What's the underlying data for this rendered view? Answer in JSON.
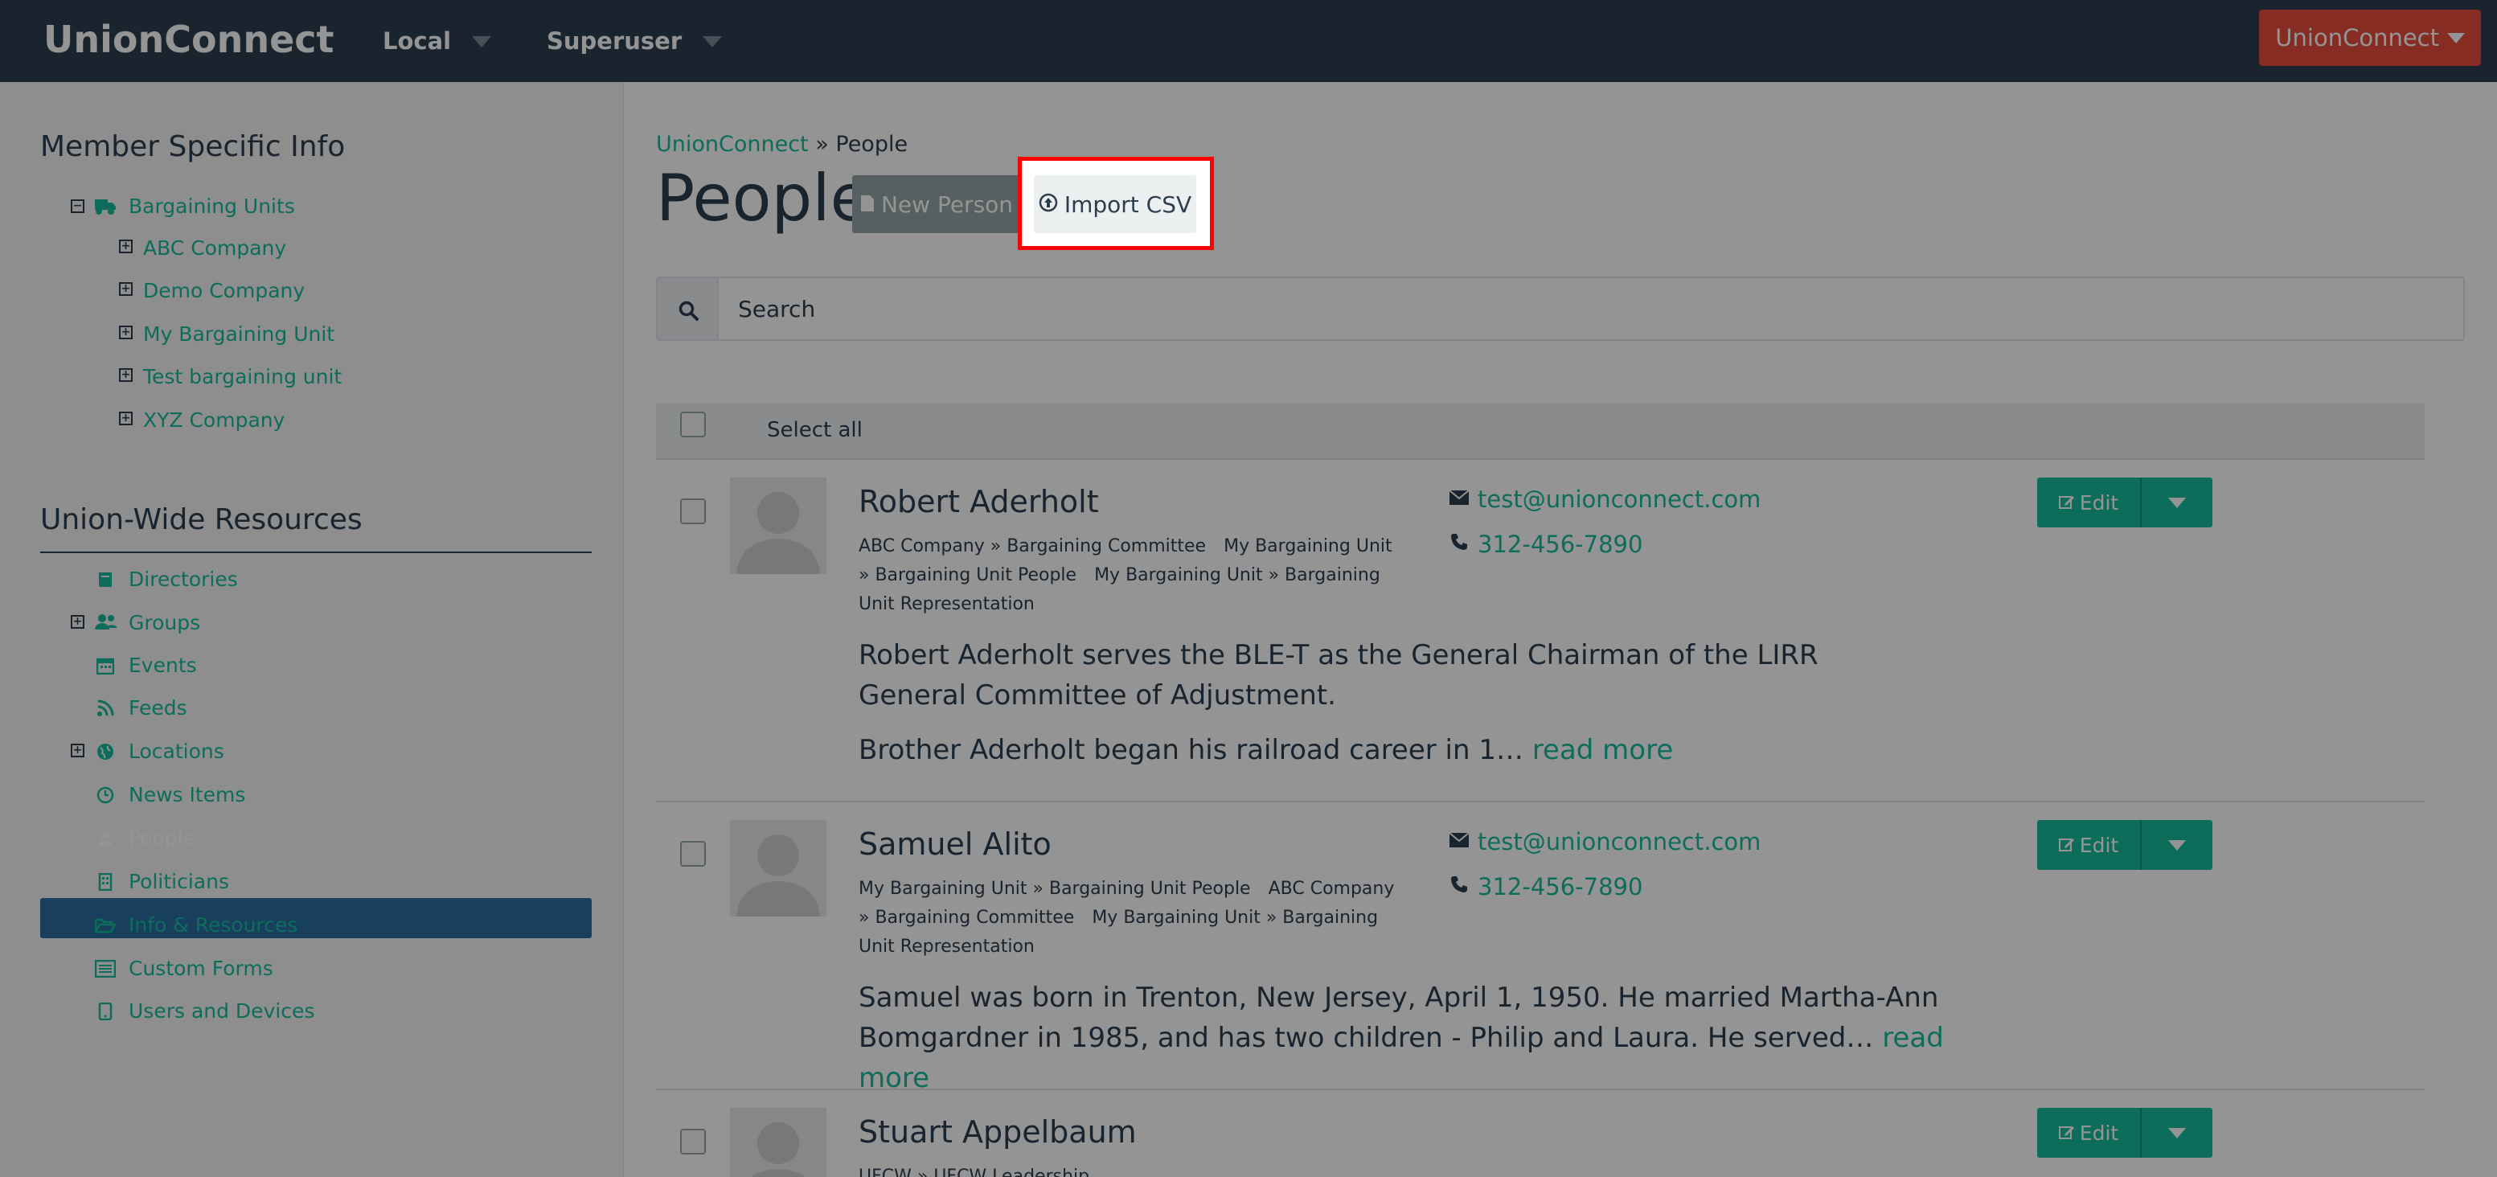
{
  "navbar": {
    "brand": "UnionConnect",
    "menus": [
      {
        "label": "Local"
      },
      {
        "label": "Superuser"
      }
    ],
    "right_button": "UnionConnect"
  },
  "sidebar": {
    "member_heading": "Member Specific Info",
    "bargaining_units": "Bargaining Units",
    "units": [
      "ABC Company",
      "Demo Company",
      "My Bargaining Unit",
      "Test bargaining unit",
      "XYZ Company"
    ],
    "resources_heading": "Union-Wide Resources",
    "resources": [
      "Directories",
      "Groups",
      "Events",
      "Feeds",
      "Locations",
      "News Items",
      "People",
      "Politicians",
      "Info & Resources",
      "Custom Forms",
      "Users and Devices"
    ]
  },
  "breadcrumb": {
    "root": "UnionConnect",
    "separator": "»",
    "current": "People"
  },
  "page_title": "People",
  "buttons": {
    "new_person": "New Person",
    "import_csv": "Import CSV"
  },
  "search": {
    "placeholder": "Search"
  },
  "select_all": "Select all",
  "people": [
    {
      "name": "Robert Aderholt",
      "tags": [
        "ABC Company » Bargaining Committee",
        "My Bargaining Unit » Bargaining Unit People",
        "My Bargaining Unit » Bargaining Unit Representation"
      ],
      "email": "test@unionconnect.com",
      "phone": "312-456-7890",
      "bio1": "Robert Aderholt serves the BLE-T as the General Chairman of the LIRR General Committee of Adjustment.",
      "bio2": "Brother Aderholt began his railroad career in 1…",
      "read_more": "read more",
      "edit": "Edit"
    },
    {
      "name": "Samuel Alito",
      "tags": [
        "My Bargaining Unit » Bargaining Unit People",
        "ABC Company » Bargaining Committee",
        "My Bargaining Unit » Bargaining Unit Representation"
      ],
      "email": "test@unionconnect.com",
      "phone": "312-456-7890",
      "bio1": "Samuel was born in Trenton, New Jersey, April 1, 1950. He married Martha-Ann Bomgardner in 1985, and has two children - Philip and Laura. He served…",
      "read_more": "read more",
      "edit": "Edit"
    },
    {
      "name": "Stuart Appelbaum",
      "tags": [
        "UFCW » UFCW Leadership"
      ],
      "edit": "Edit"
    }
  ],
  "colors": {
    "navbar": "#2c3e50",
    "accent": "#18bc9c",
    "danger": "#e74c3c",
    "active": "#2c6da4",
    "highlight": "#ff0000"
  }
}
